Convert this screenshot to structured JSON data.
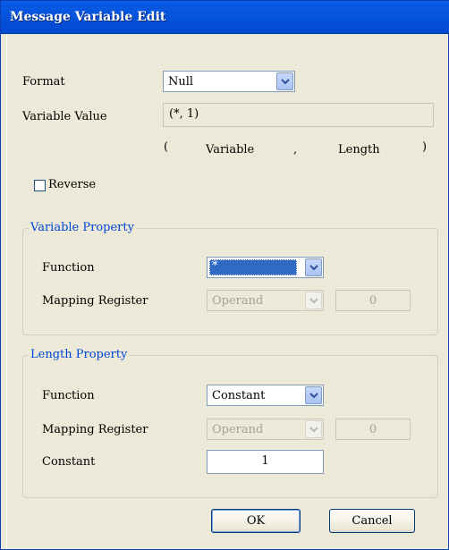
{
  "window": {
    "title": "Message Variable Edit"
  },
  "format": {
    "label": "Format",
    "value": "Null"
  },
  "variable_value": {
    "label": "Variable Value",
    "value": "(*, 1)"
  },
  "syntax_hint": {
    "open": "(",
    "variable": "Variable",
    "comma": ",",
    "length": "Length",
    "close": ")"
  },
  "reverse": {
    "label": "Reverse",
    "checked": false
  },
  "variable_property": {
    "title": "Variable Property",
    "function_label": "Function",
    "function_value": "*",
    "mapping_label": "Mapping Register",
    "mapping_value": "Operand",
    "mapping_number": "0"
  },
  "length_property": {
    "title": "Length Property",
    "function_label": "Function",
    "function_value": "Constant",
    "mapping_label": "Mapping Register",
    "mapping_value": "Operand",
    "mapping_number": "0",
    "constant_label": "Constant",
    "constant_value": "1"
  },
  "buttons": {
    "ok": "OK",
    "cancel": "Cancel"
  },
  "icons": {
    "dropdown": "chevron-down-icon"
  },
  "colors": {
    "titlebar": "#0a5ce6",
    "group_label": "#0046d5",
    "selection": "#316ac5"
  }
}
